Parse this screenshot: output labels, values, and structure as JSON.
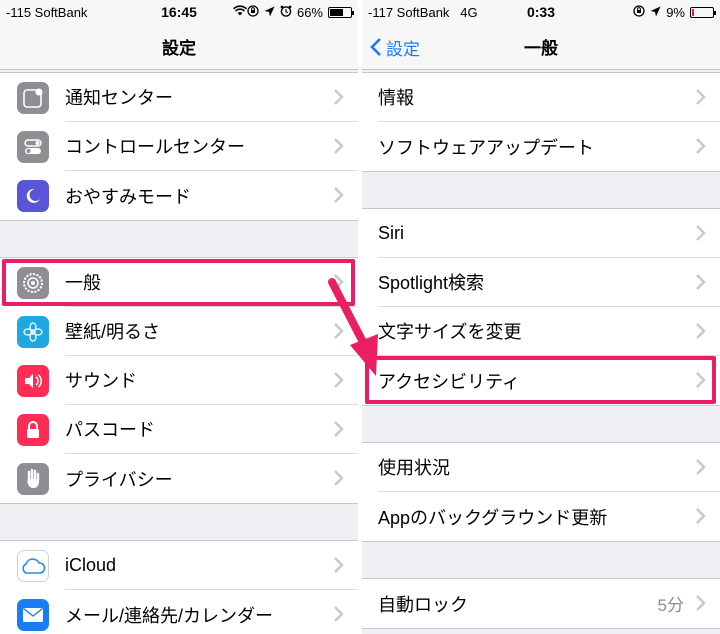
{
  "left": {
    "status": {
      "carrier": "-115 SoftBank",
      "time": "16:45",
      "battery": "66%"
    },
    "nav": {
      "title": "設定"
    },
    "groups": [
      [
        {
          "label": "通知センター",
          "icon": "notification-center-icon",
          "color": "#8e8e93"
        },
        {
          "label": "コントロールセンター",
          "icon": "control-center-icon",
          "color": "#8e8e93"
        },
        {
          "label": "おやすみモード",
          "icon": "moon-icon",
          "color": "#5856d6"
        }
      ],
      [
        {
          "label": "一般",
          "icon": "gear-icon",
          "color": "#8e8e93"
        },
        {
          "label": "壁紙/明るさ",
          "icon": "flower-icon",
          "color": "#1ea7e1"
        },
        {
          "label": "サウンド",
          "icon": "speaker-icon",
          "color": "#ff2d55"
        },
        {
          "label": "パスコード",
          "icon": "lock-icon",
          "color": "#ff2d55"
        },
        {
          "label": "プライバシー",
          "icon": "hand-icon",
          "color": "#8e8e93"
        }
      ],
      [
        {
          "label": "iCloud",
          "icon": "cloud-icon",
          "color": "#ffffff"
        },
        {
          "label": "メール/連絡先/カレンダー",
          "icon": "mail-icon",
          "color": "#1a7cf5"
        }
      ]
    ]
  },
  "right": {
    "status": {
      "carrier": "-117 SoftBank",
      "network": "4G",
      "time": "0:33",
      "battery": "9%"
    },
    "nav": {
      "back": "設定",
      "title": "一般"
    },
    "groups": [
      [
        {
          "label": "情報"
        },
        {
          "label": "ソフトウェアアップデート"
        }
      ],
      [
        {
          "label": "Siri"
        },
        {
          "label": "Spotlight検索"
        },
        {
          "label": "文字サイズを変更"
        },
        {
          "label": "アクセシビリティ"
        }
      ],
      [
        {
          "label": "使用状況"
        },
        {
          "label": "Appのバックグラウンド更新"
        }
      ],
      [
        {
          "label": "自動ロック",
          "value": "5分"
        }
      ]
    ]
  },
  "colors": {
    "highlight": "#e91e63",
    "accent": "#1a7cf5"
  },
  "battery_levels": {
    "left": 0.66,
    "right": 0.09
  }
}
